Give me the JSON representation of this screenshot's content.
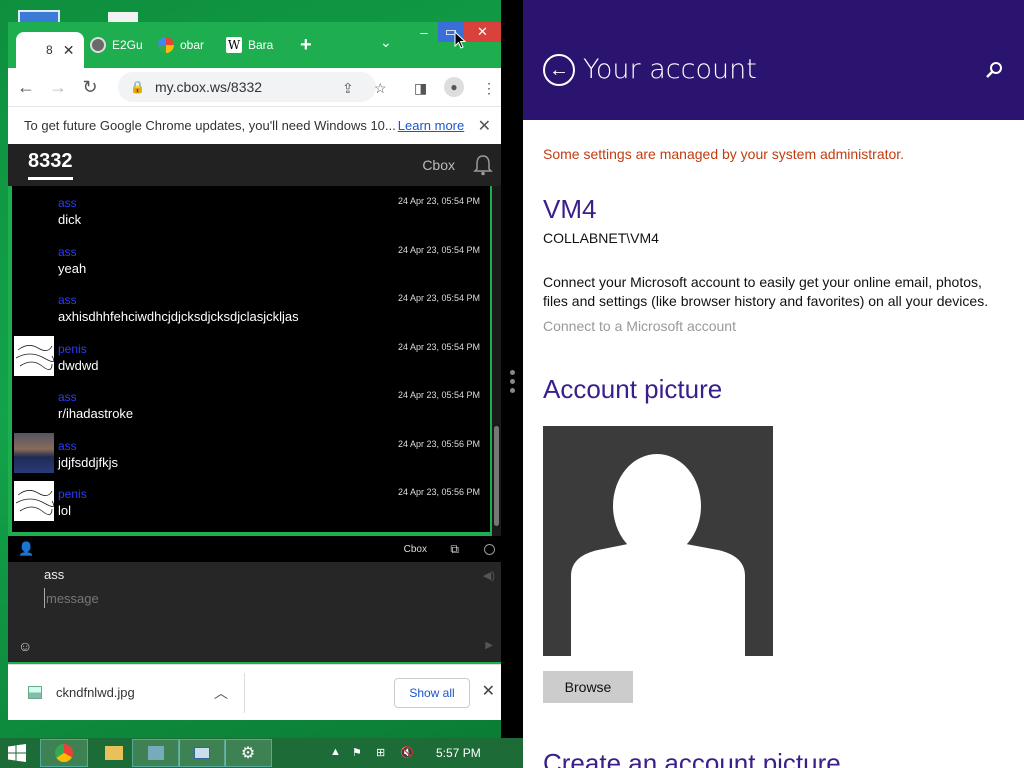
{
  "browser": {
    "tabs": [
      {
        "label": "8",
        "icon": "cbox-icon"
      },
      {
        "label": "E2Gu",
        "icon": "globe-icon"
      },
      {
        "label": "obar",
        "icon": "google-icon"
      },
      {
        "label": "Bara",
        "icon": "wikipedia-icon"
      }
    ],
    "url": "my.cbox.ws/8332",
    "infobar_text": "To get future Google Chrome updates, you'll need Windows 10...",
    "infobar_link": "Learn more"
  },
  "cbox": {
    "title": "8332",
    "brand": "Cbox",
    "messages": [
      {
        "name": "ass",
        "text": "dick",
        "time": "24 Apr 23, 05:54 PM",
        "avatar": "none"
      },
      {
        "name": "ass",
        "text": "yeah",
        "time": "24 Apr 23, 05:54 PM",
        "avatar": "none"
      },
      {
        "name": "ass",
        "text": "axhisdhhfehciwdhcjdjcksdjcksdjclasjckljas",
        "time": "24 Apr 23, 05:54 PM",
        "avatar": "none"
      },
      {
        "name": "penis",
        "text": "dwdwd",
        "time": "24 Apr 23, 05:54 PM",
        "avatar": "scribble"
      },
      {
        "name": "ass",
        "text": "r/ihadastroke",
        "time": "24 Apr 23, 05:54 PM",
        "avatar": "none"
      },
      {
        "name": "ass",
        "text": "jdjfsddjfkjs",
        "time": "24 Apr 23, 05:56 PM",
        "avatar": "photo"
      },
      {
        "name": "penis",
        "text": "lol",
        "time": "24 Apr 23, 05:56 PM",
        "avatar": "scribble"
      }
    ],
    "footer_brand": "Cbox",
    "compose_name": "ass",
    "compose_placeholder": "message"
  },
  "downloads": {
    "filename": "ckndfnlwd.jpg",
    "show_all": "Show all"
  },
  "settings": {
    "title": "Your account",
    "admin_notice": "Some settings are managed by your system administrator.",
    "account_name": "VM4",
    "account_id": "COLLABNET\\VM4",
    "description": "Connect your Microsoft account to easily get your online email, photos, files and settings (like browser history and favorites) on all your devices.",
    "ms_link": "Connect to a Microsoft account",
    "picture_heading": "Account picture",
    "browse": "Browse",
    "create_heading": "Create an account picture"
  },
  "taskbar": {
    "clock": "5:57 PM"
  },
  "colors": {
    "settings_header": "#2a1470",
    "settings_accent": "#3a1e8a",
    "admin_warning": "#c43c10",
    "cbox_name": "#2b3cff"
  }
}
